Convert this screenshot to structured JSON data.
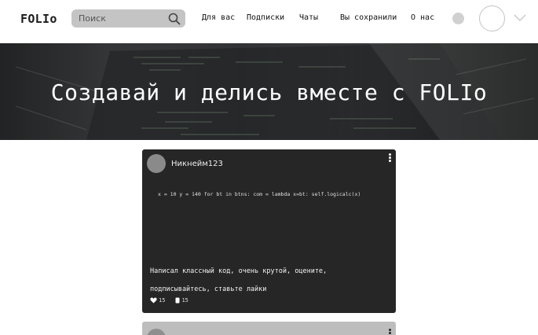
{
  "header": {
    "logo": "FOLIo",
    "search_placeholder": "Поиск",
    "nav": [
      "Для вас",
      "Подписки",
      "Чаты",
      "Вы сохранили",
      "О нас"
    ]
  },
  "hero": {
    "title": "Создавай и делись вместе с FOLIo"
  },
  "posts": [
    {
      "nickname": "Никнейм123",
      "code": "x = 10 y = 140 for bt in btns: com = lambda x=bt: self.logicalc(x)",
      "text": "Написал классный код, очень крутой, оцените, подписывайтесь, ставьте лайки",
      "likes": "15",
      "comments": "15"
    }
  ],
  "icons": {
    "search": "search-icon",
    "chevron": "chevron-down-icon",
    "like": "heart-icon",
    "comment": "comment-icon",
    "menu": "kebab-menu-icon"
  },
  "colors": {
    "search_bg": "#c4c4c4",
    "post_bg": "#262626",
    "post_muted_bg": "#bdbdbd",
    "hero_text": "#ffffff"
  }
}
